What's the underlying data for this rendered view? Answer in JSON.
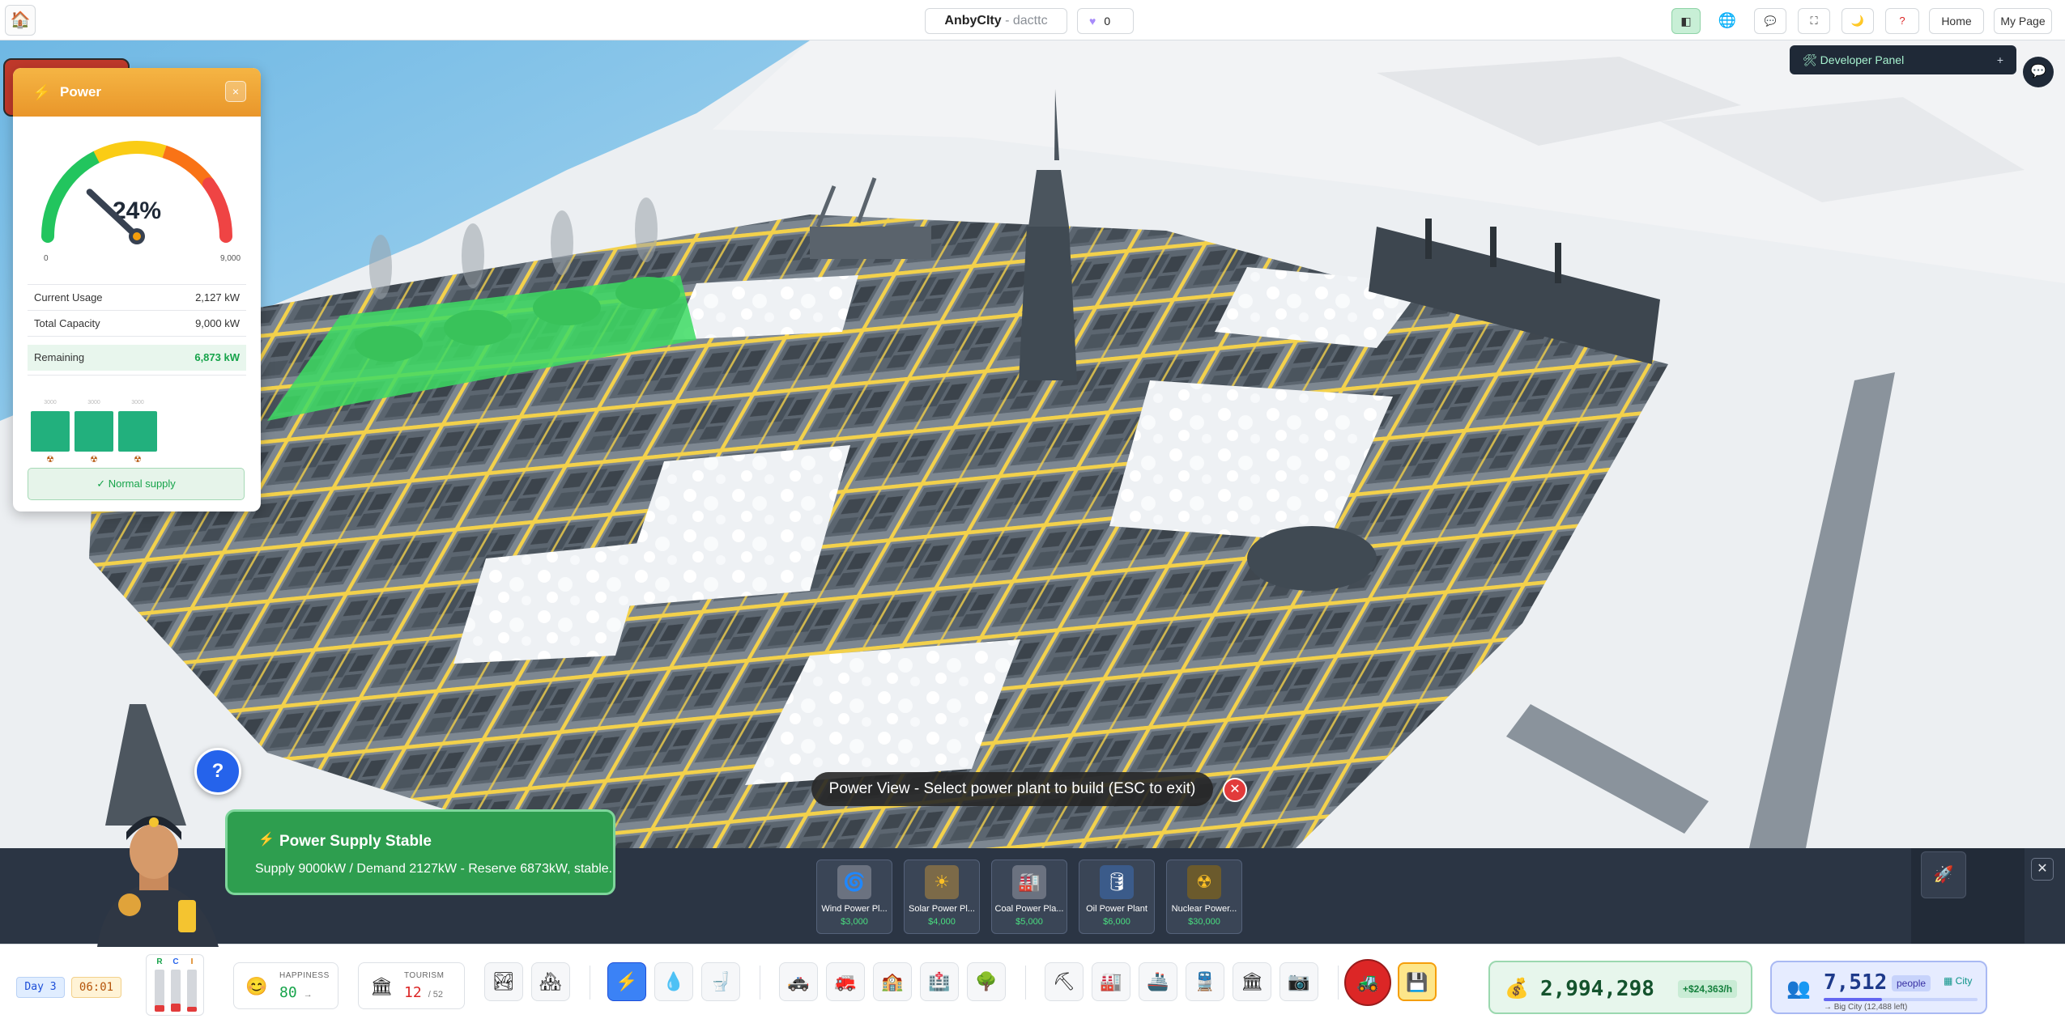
{
  "topbar": {
    "home_icon": "house-icon",
    "city_name": "AnbyCIty",
    "separator": " - ",
    "owner": "dacttc",
    "likes_icon": "heart-icon",
    "likes": "0",
    "buttons": [
      {
        "id": "power-view",
        "icon": "power-view-icon",
        "glyph": "◧",
        "active": true
      },
      {
        "id": "language",
        "icon": "globe-icon",
        "glyph": "🌐"
      },
      {
        "id": "chat",
        "icon": "speech-bubble-icon",
        "glyph": "💬"
      },
      {
        "id": "fullscreen",
        "icon": "fullscreen-icon",
        "glyph": "⛶"
      },
      {
        "id": "night-mode",
        "icon": "moon-icon",
        "glyph": "🌙"
      },
      {
        "id": "help",
        "icon": "question-icon",
        "glyph": "❓"
      }
    ],
    "home_label": "Home",
    "mypage_label": "My Page"
  },
  "developer_panel": {
    "icon": "wrench-icon",
    "label": "Developer Panel",
    "expand": "+"
  },
  "power_panel": {
    "title": "Power",
    "close": "×",
    "gauge": {
      "percent": 24,
      "label": "24%",
      "min_label": "0",
      "max_label": "9,000",
      "colors": [
        "#22c55e",
        "#facc15",
        "#f97316",
        "#ef4444"
      ]
    },
    "stats": [
      {
        "label": "Current Usage",
        "value": "2,127 kW"
      },
      {
        "label": "Total Capacity",
        "value": "9,000 kW"
      }
    ],
    "remaining": {
      "label": "Remaining",
      "value": "6,873 kW"
    },
    "plants": [
      {
        "icon": "radiation-icon",
        "cap": "3000",
        "fill": 1.0
      },
      {
        "icon": "radiation-icon",
        "cap": "3000",
        "fill": 1.0
      },
      {
        "icon": "radiation-icon",
        "cap": "3000",
        "fill": 1.0
      }
    ],
    "status": "✓ Normal supply"
  },
  "mode_banner": "Power View - Select power plant to build (ESC to exit)",
  "notice": {
    "title": "Power Supply Stable",
    "message": "Supply 9000kW / Demand 2127kW - Reserve 6873kW, stable."
  },
  "build_menu": [
    {
      "name": "Wind Power Pl...",
      "price": "$3,000",
      "icon": "wind-turbine-icon",
      "glyph": "🌀"
    },
    {
      "name": "Solar Power Pl...",
      "price": "$4,000",
      "icon": "sun-icon",
      "glyph": "☀"
    },
    {
      "name": "Coal Power Pla...",
      "price": "$5,000",
      "icon": "factory-icon",
      "glyph": "🏭"
    },
    {
      "name": "Oil Power Plant",
      "price": "$6,000",
      "icon": "oil-barrel-icon",
      "glyph": "🛢"
    },
    {
      "name": "Nuclear Power...",
      "price": "$30,000",
      "icon": "radiation-icon",
      "glyph": "☢"
    }
  ],
  "status_bar": {
    "day": "Day 3",
    "time": "06:01",
    "rci": {
      "labels": [
        "R",
        "C",
        "I"
      ],
      "levels": [
        0.15,
        0.2,
        0.12
      ],
      "colors": [
        "#16a34a",
        "#2563eb",
        "#d97706"
      ]
    },
    "happiness": {
      "label": "HAPPINESS",
      "value": "80",
      "trend": "→"
    },
    "tourism": {
      "label": "TOURISM",
      "value": "12",
      "sub": "/ 52"
    },
    "money": {
      "value": "2,994,298",
      "rate": "+$24,363/h"
    },
    "population": {
      "value": "7,512",
      "unit": "people",
      "tier": "City",
      "next": "→ Big City (12,488 left)",
      "progress": 0.38
    }
  }
}
